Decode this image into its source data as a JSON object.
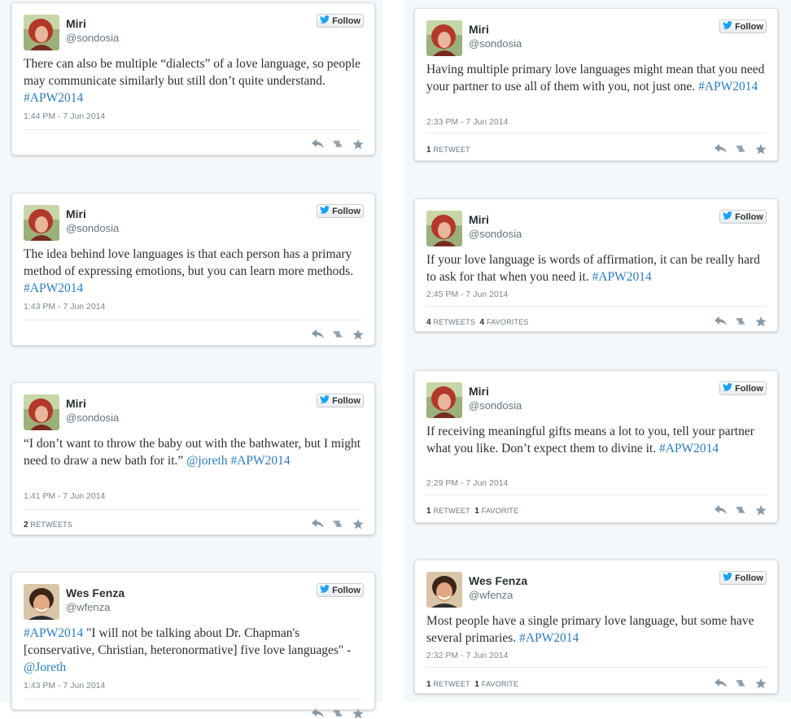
{
  "tweets": [
    {
      "name": "Miri",
      "handle": "@sondosia",
      "follow": "Follow",
      "avatar": "red-hair-avatar",
      "text_parts": [
        {
          "t": "There can also be multiple “dialects” of a love language, so people may communicate similarly but still don’t quite understand. "
        },
        {
          "t": "#APW2014",
          "k": "tag"
        }
      ],
      "time": "1:44 PM - 7 Jun 2014"
    },
    {
      "name": "Miri",
      "handle": "@sondosia",
      "follow": "Follow",
      "avatar": "red-hair-avatar",
      "text_parts": [
        {
          "t": "The idea behind love languages is that each person has a primary method of expressing emotions, but you can learn more methods. "
        },
        {
          "t": "#APW2014",
          "k": "tag"
        }
      ],
      "time": "1:43 PM - 7 Jun 2014"
    },
    {
      "name": "Miri",
      "handle": "@sondosia",
      "follow": "Follow",
      "avatar": "red-hair-avatar",
      "text_parts": [
        {
          "t": "“I don’t want to throw the baby out with the bathwater, but I might need to draw a new bath for it.” "
        },
        {
          "t": "@joreth",
          "k": "mention"
        },
        {
          "t": " "
        },
        {
          "t": "#APW2014",
          "k": "tag"
        }
      ],
      "time": "1:41 PM - 7 Jun 2014",
      "stats": [
        {
          "n": "2",
          "label": "RETWEETS"
        }
      ]
    },
    {
      "name": "Wes Fenza",
      "handle": "@wfenza",
      "follow": "Follow",
      "avatar": "dark-hair-avatar",
      "text_parts": [
        {
          "t": "#APW2014",
          "k": "tag"
        },
        {
          "t": " \"I will not be talking about Dr. Chapman's [conservative, Christian, heteronormative] five love languages\" - "
        },
        {
          "t": "@Joreth",
          "k": "mention"
        }
      ],
      "time": "1:43 PM - 7 Jun 2014"
    },
    {
      "name": "Miri",
      "handle": "@sondosia",
      "follow": "Follow",
      "avatar": "red-hair-avatar",
      "text_parts": [
        {
          "t": "Having multiple primary love languages might mean that you need your partner to use all of them with you, not just one. "
        },
        {
          "t": "#APW2014",
          "k": "tag"
        }
      ],
      "time": "2:33 PM - 7 Jun 2014",
      "stats": [
        {
          "n": "1",
          "label": "RETWEET"
        }
      ]
    },
    {
      "name": "Miri",
      "handle": "@sondosia",
      "follow": "Follow",
      "avatar": "red-hair-avatar",
      "text_parts": [
        {
          "t": "If your love language is words of affirmation, it can be really hard to ask for that when you need it. "
        },
        {
          "t": "#APW2014",
          "k": "tag"
        }
      ],
      "time": "2:45 PM - 7 Jun 2014",
      "stats": [
        {
          "n": "4",
          "label": "RETWEETS"
        },
        {
          "n": "4",
          "label": "FAVORITES"
        }
      ]
    },
    {
      "name": "Miri",
      "handle": "@sondosia",
      "follow": "Follow",
      "avatar": "red-hair-avatar",
      "text_parts": [
        {
          "t": "If receiving meaningful gifts means a lot to you, tell your partner what you like. Don’t expect them to divine it. "
        },
        {
          "t": "#APW2014",
          "k": "tag"
        }
      ],
      "time": "2:29 PM - 7 Jun 2014",
      "stats": [
        {
          "n": "1",
          "label": "RETWEET"
        },
        {
          "n": "1",
          "label": "FAVORITE"
        }
      ]
    },
    {
      "name": "Wes Fenza",
      "handle": "@wfenza",
      "follow": "Follow",
      "avatar": "dark-hair-avatar",
      "text_parts": [
        {
          "t": "Most people have a single primary love language, but some have several primaries. "
        },
        {
          "t": "#APW2014",
          "k": "tag"
        }
      ],
      "time": "2:32 PM - 7 Jun 2014",
      "stats": [
        {
          "n": "1",
          "label": "RETWEET"
        },
        {
          "n": "1",
          "label": "FAVORITE"
        }
      ]
    }
  ],
  "colors": {
    "link": "#2b7bb9",
    "twitter_bird": "#1da1f2",
    "action_icon": "#8899a6"
  }
}
